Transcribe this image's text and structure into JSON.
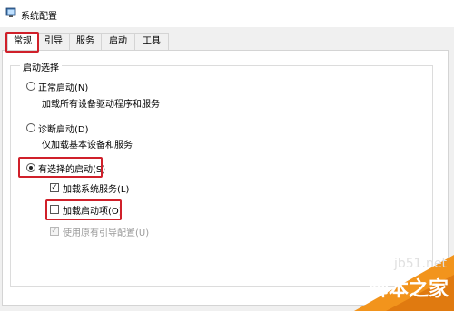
{
  "window": {
    "title": "系统配置"
  },
  "tabs": [
    {
      "label": "常规"
    },
    {
      "label": "引导"
    },
    {
      "label": "服务"
    },
    {
      "label": "启动"
    },
    {
      "label": "工具"
    }
  ],
  "startup": {
    "group_title": "启动选择",
    "normal": {
      "label": "正常启动(N)",
      "desc": "加载所有设备驱动程序和服务"
    },
    "diagnostic": {
      "label": "诊断启动(D)",
      "desc": "仅加载基本设备和服务"
    },
    "selective": {
      "label": "有选择的启动(S)"
    },
    "load_services": {
      "label": "加载系统服务(L)",
      "checked": true
    },
    "load_startup": {
      "label": "加载启动项(O)",
      "checked": false
    },
    "use_original_boot": {
      "label": "使用原有引导配置(U)",
      "checked": true,
      "disabled": true
    }
  },
  "watermark": {
    "url": "jb51.net",
    "text": "脚本之家"
  },
  "colors": {
    "highlight": "#d0202a",
    "watermark_orange": "#f2941c"
  }
}
